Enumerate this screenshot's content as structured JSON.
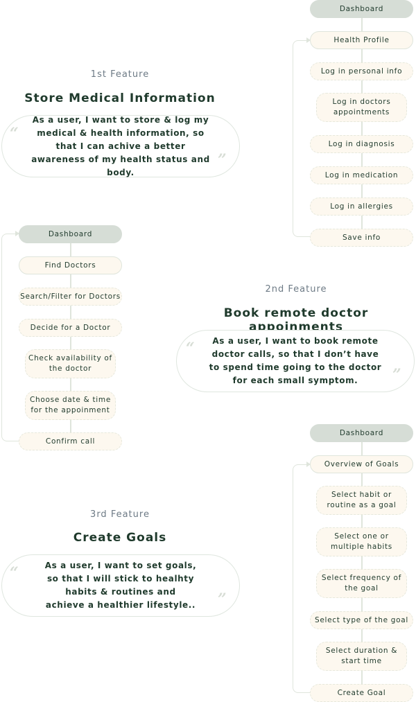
{
  "feature1": {
    "label": "1st Feature",
    "title": "Store Medical Information",
    "story": "As a user, I want to store & log my medical & health information, so that I can achive a better awareness of my health status and body."
  },
  "feature2": {
    "label": "2nd Feature",
    "title": "Book remote doctor appoinments",
    "story": "As a user, I want to book remote doctor calls, so that I don’t have to spend time going to the doctor for each small symptom."
  },
  "feature3": {
    "label": "3rd Feature",
    "title": "Create Goals",
    "story": "As a user, I want to set goals, so that I will stick to healhty habits & routines and achieve a healthier lifestyle.."
  },
  "flow1": {
    "head": "Dashboard",
    "steps": [
      "Health Profile",
      "Log in personal info",
      "Log in doctors appointments",
      "Log in diagnosis",
      "Log in medication",
      "Log in allergies",
      "Save info"
    ]
  },
  "flow2": {
    "head": "Dashboard",
    "steps": [
      "Find Doctors",
      "Search/Filter for Doctors",
      "Decide for a Doctor",
      "Check availability of the doctor",
      "Choose date & time for the appoinment",
      "Confirm call"
    ]
  },
  "flow3": {
    "head": "Dashboard",
    "steps": [
      "Overview of Goals",
      "Select habit or routine as a goal",
      "Select one or multiple habits",
      "Select frequency of the goal",
      "Select type of the goal",
      "Select duration & start time",
      "Create Goal"
    ]
  },
  "quote_open": "“",
  "quote_close": "”"
}
